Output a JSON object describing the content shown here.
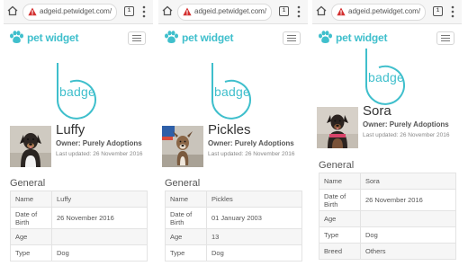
{
  "browser": {
    "url": "adgeid.petwidget.com/",
    "tabs_count": "1",
    "warning_color": "#d32f2f"
  },
  "app": {
    "brand": "pet widget",
    "brand_color": "#3fbfcc",
    "badge_label": "badge"
  },
  "labels": {
    "general": "General",
    "name": "Name",
    "dob": "Date of Birth",
    "age": "Age",
    "type": "Type",
    "breed": "Breed"
  },
  "screens": [
    {
      "pet_name": "Luffy",
      "owner": "Owner: Purely Adoptions",
      "updated": "Last updated: 26 November 2016",
      "fields": {
        "name": "Luffy",
        "dob": "26 November 2016",
        "age": "",
        "type": "Dog"
      }
    },
    {
      "pet_name": "Pickles",
      "owner": "Owner: Purely Adoptions",
      "updated": "Last updated: 26 November 2016",
      "fields": {
        "name": "Pickles",
        "dob": "01 January 2003",
        "age": "13",
        "type": "Dog"
      }
    },
    {
      "pet_name": "Sora",
      "owner": "Owner: Purely Adoptions",
      "updated": "Last updated: 26 November 2016",
      "fields": {
        "name": "Sora",
        "dob": "26 November 2016",
        "age": "",
        "type": "Dog",
        "breed": "Others"
      }
    }
  ]
}
